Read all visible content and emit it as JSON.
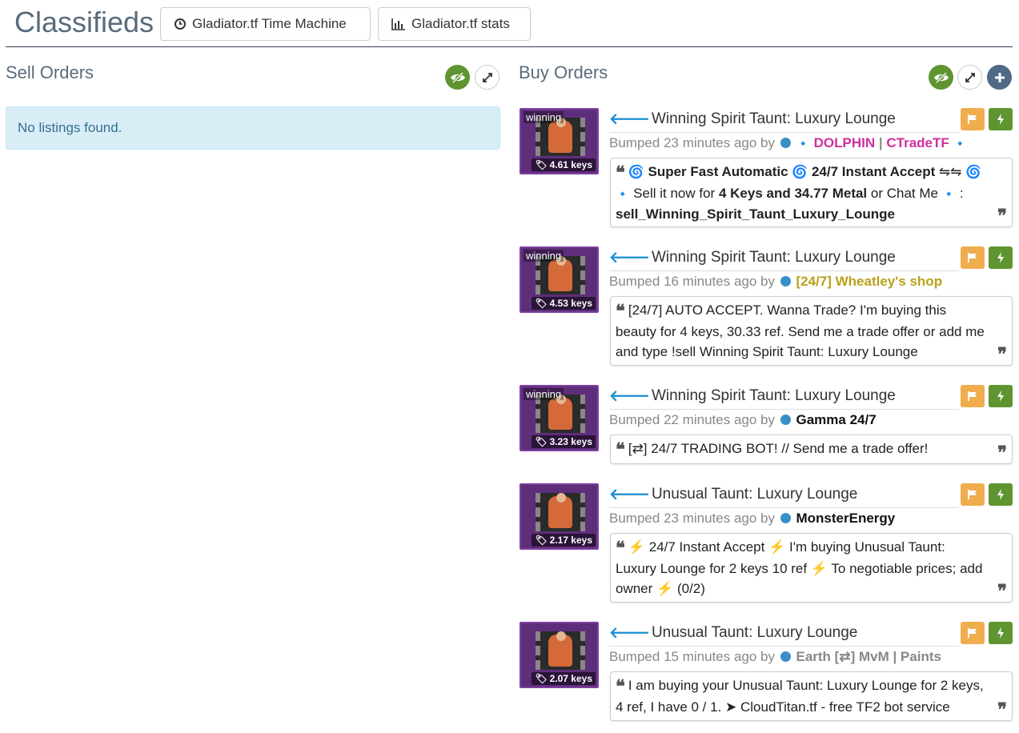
{
  "header": {
    "title": "Classifieds",
    "time_machine_label": "Gladiator.tf Time Machine",
    "stats_label": "Gladiator.tf stats"
  },
  "sell": {
    "heading": "Sell Orders",
    "empty_text": "No listings found."
  },
  "buy": {
    "heading": "Buy Orders",
    "bumped_prefix": "Bumped",
    "by_label": "by",
    "listings": [
      {
        "title": "Winning Spirit Taunt: Luxury Lounge",
        "effect": "winning",
        "price": "4.61 keys",
        "bumped": "23 minutes ago",
        "user_parts": [
          "DOLPHIN",
          " | ",
          "CTradeTF"
        ],
        "user_color": "#cf2f9b",
        "msg_parts": [
          "Super Fast Automatic",
          "24/7 Instant Accept",
          "⇋⇋",
          "Sell it now for",
          "4 Keys and 34.77 Metal",
          "or Chat Me",
          ":",
          "sell_Winning_Spirit_Taunt_Luxury_Lounge"
        ]
      },
      {
        "title": "Winning Spirit Taunt: Luxury Lounge",
        "effect": "winning",
        "price": "4.53 keys",
        "bumped": "16 minutes ago",
        "user": "[24/7] Wheatley's shop",
        "user_color": "#b8a11a",
        "message": "[24/7] AUTO ACCEPT. Wanna Trade? I'm buying this beauty for 4 keys, 30.33 ref. Send me a trade offer or add me and type !sell Winning Spirit Taunt: Luxury Lounge"
      },
      {
        "title": "Winning Spirit Taunt: Luxury Lounge",
        "effect": "winning",
        "price": "3.23 keys",
        "bumped": "22 minutes ago",
        "user": "Gamma 24/7",
        "user_color": "#111111",
        "message": "[⇄] 24/7 TRADING BOT! // Send me a trade offer!"
      },
      {
        "title": "Unusual Taunt: Luxury Lounge",
        "price": "2.17 keys",
        "bumped": "23 minutes ago",
        "user": "MonsterEnergy",
        "user_color": "#111111",
        "msg_parts": [
          "24/7 Instant Accept",
          "I'm buying Unusual Taunt: Luxury Lounge for 2 keys 10 ref",
          "To negotiable prices; add owner",
          "(0/2)"
        ]
      },
      {
        "title": "Unusual Taunt: Luxury Lounge",
        "price": "2.07 keys",
        "bumped": "15 minutes ago",
        "user": "Earth [⇄] MvM | Paints",
        "user_color": "#888888",
        "message": "I am buying your Unusual Taunt: Luxury Lounge for 2 keys, 4 ref, I have 0 / 1. ➤ CloudTitan.tf - free TF2 bot service"
      }
    ]
  },
  "colors": {
    "accent_green": "#5e9530",
    "flag_orange": "#f0ad4e",
    "info_bg": "#d9edf7",
    "thumb_purple": "#5e2e7a"
  }
}
